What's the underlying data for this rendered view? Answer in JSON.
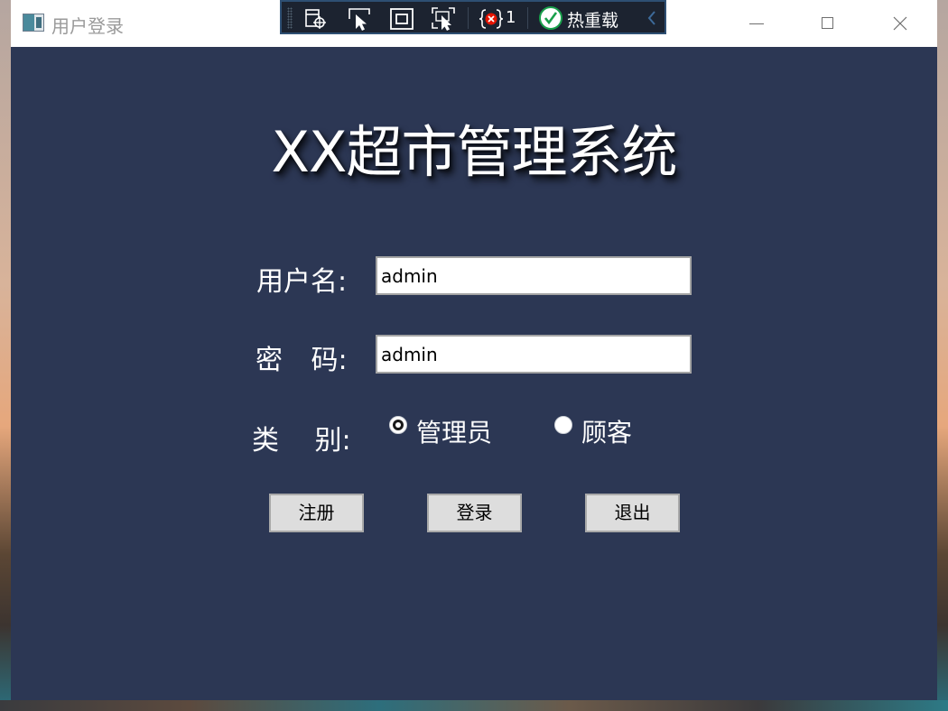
{
  "window": {
    "title": "用户登录"
  },
  "debug_toolbar": {
    "error_count": "1",
    "hot_reload_label": "热重载",
    "icons": [
      "select-element-icon",
      "inspect-pointer-icon",
      "layout-adorner-icon",
      "track-focus-icon",
      "binding-error-icon",
      "hot-reload-check-icon",
      "collapse-chevron-icon"
    ]
  },
  "main": {
    "app_title": "XX超市管理系统",
    "username_label": "用户名:",
    "password_label": "密 码:",
    "type_label": "类 别:",
    "username_value": "admin",
    "password_value": "admin",
    "role_options": [
      {
        "label": "管理员",
        "selected": true
      },
      {
        "label": "顾客",
        "selected": false
      }
    ],
    "buttons": {
      "register": "注册",
      "login": "登录",
      "exit": "退出"
    }
  },
  "colors": {
    "window_background": "#2c3754",
    "titlebar_background": "#ffffff",
    "button_background": "#dddddd",
    "toolbar_background": "#1c2330",
    "hot_reload_check": "#19a04b"
  }
}
